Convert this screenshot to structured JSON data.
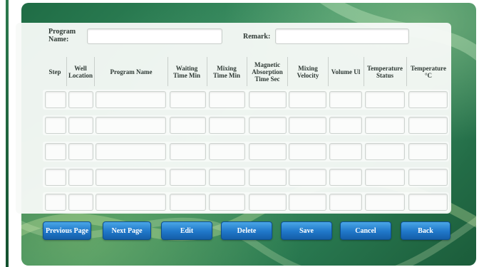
{
  "form": {
    "program_name_label": "Program Name:",
    "program_name_value": "",
    "remark_label": "Remark:",
    "remark_value": ""
  },
  "table": {
    "columns": [
      "Step",
      "Well Location",
      "Program Name",
      "Waiting Time Min",
      "Mixing Time Min",
      "Magnetic Absorption Time Sec",
      "Mixing Velocity",
      "Volume Ul",
      "Temperature Status",
      "Temperature °C"
    ],
    "rows": [
      [
        "",
        "",
        "",
        "",
        "",
        "",
        "",
        "",
        "",
        ""
      ],
      [
        "",
        "",
        "",
        "",
        "",
        "",
        "",
        "",
        "",
        ""
      ],
      [
        "",
        "",
        "",
        "",
        "",
        "",
        "",
        "",
        "",
        ""
      ],
      [
        "",
        "",
        "",
        "",
        "",
        "",
        "",
        "",
        "",
        ""
      ],
      [
        "",
        "",
        "",
        "",
        "",
        "",
        "",
        "",
        "",
        ""
      ]
    ]
  },
  "buttons": {
    "previous_page": "Previous Page",
    "next_page": "Next Page",
    "edit": "Edit",
    "delete": "Delete",
    "save": "Save",
    "cancel": "Cancel",
    "back": "Back"
  },
  "colors": {
    "background_green": "#2a7b52",
    "button_blue": "#1f77c9",
    "panel": "#f8faf8"
  }
}
